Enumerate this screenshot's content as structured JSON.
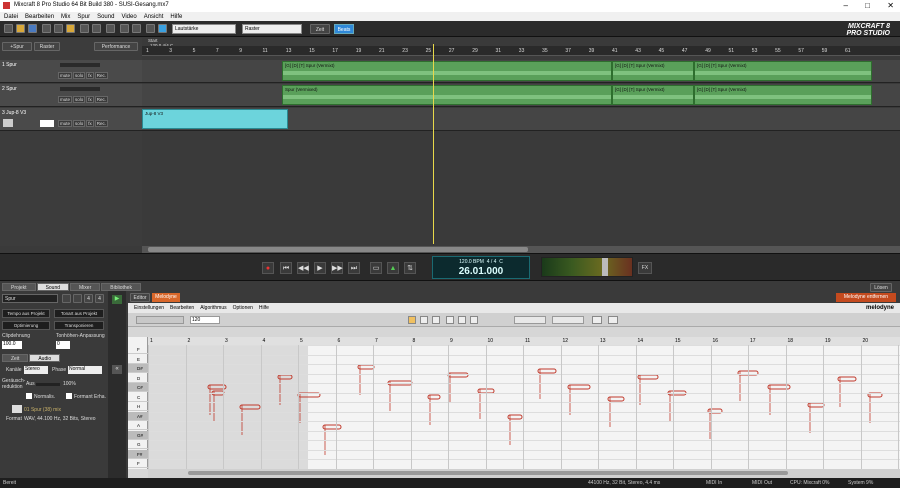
{
  "window": {
    "title": "Mixcraft 8 Pro Studio 64 Bit Build 380 - SUSI-Gesang.mx7"
  },
  "menu": [
    "Datei",
    "Bearbeiten",
    "Mix",
    "Spur",
    "Sound",
    "Video",
    "Ansicht",
    "Hilfe"
  ],
  "toolbar": {
    "volume_combo": "Lautstärke",
    "snap_combo": "Raster",
    "zeit": "Zeit",
    "beats": "Beats"
  },
  "logo": {
    "line1": "MIXCRAFT 8",
    "line2": "PRO STUDIO"
  },
  "trackheader": {
    "add": "+Spur",
    "raster": "Raster",
    "performance": "Performance",
    "mute": "mute",
    "solo": "solo",
    "fx": "fx",
    "rec": "Rec."
  },
  "tracks": [
    {
      "name": "1 Spur"
    },
    {
      "name": "2 Spur"
    },
    {
      "name": "3 Jup-8 V3"
    }
  ],
  "ruler": {
    "start": "Start",
    "tempo": "120.0 4/4 C",
    "bars": [
      "1",
      "3",
      "5",
      "7",
      "9",
      "11",
      "13",
      "15",
      "17",
      "19",
      "21",
      "23",
      "25",
      "27",
      "29",
      "31",
      "33",
      "35",
      "37",
      "39",
      "41",
      "43",
      "45",
      "47",
      "49",
      "51",
      "53",
      "55",
      "57",
      "59",
      "61"
    ]
  },
  "clips": {
    "audio": "Spur (Vermixed)",
    "audio_alt": "[G] [D] [T] Spur (Vermixt)",
    "midi": "Jup-8 V3"
  },
  "transport": {
    "bpm": "120.0 BPM",
    "sig": "4 / 4",
    "key": "C",
    "time": "26.01.000",
    "fx": "FX"
  },
  "lower_tabs": [
    "Projekt",
    "Sound",
    "Mixer",
    "Bibliothek"
  ],
  "lower_active": "Sound",
  "unlock": "Lösen",
  "left": {
    "track_name": "Spur",
    "num1": "4",
    "num2": "4",
    "tempo_proj": "Tempo aus Projekt",
    "tonart_proj": "Tonart aus Projekt",
    "opt": "Optimierung",
    "transp": "Transponieren",
    "clipdehnung": "Clipdehnung",
    "tonhoehe": "Tonhöhen-Anpassung",
    "val1": "100.0",
    "val2": "0",
    "tab_zeit": "Zeit",
    "tab_audio": "Audio",
    "kanale": "Kanäle",
    "kanale_val": "Stereo",
    "phase": "Phase",
    "phase_val": "Normal",
    "gerausch": "Geräusch-reduktion",
    "aus": "Aus",
    "pct": "100%",
    "normal": "Normalis.",
    "formant": "Formant Erha.",
    "file": "01 Spur (38) mix",
    "format_lbl": "Format",
    "format": "WAV, 44.100 Hz, 32 Bits, Stereo"
  },
  "melodyne": {
    "edit": "Editor",
    "plugin": "Melodyne",
    "remove": "Melodyne entfernen",
    "menu": [
      "Einstellungen",
      "Bearbeiten",
      "Algorithmus",
      "Optionen",
      "Hilfe"
    ],
    "brand": "melodyne",
    "zoom": "120",
    "keys": [
      "F",
      "E",
      "D#",
      "D",
      "C#",
      "C",
      "H",
      "A#",
      "A",
      "G#",
      "G",
      "F#",
      "F"
    ],
    "bars": [
      "1",
      "2",
      "3",
      "4",
      "5",
      "6",
      "7",
      "8",
      "9",
      "10",
      "11",
      "12",
      "13",
      "14",
      "15",
      "16",
      "17",
      "18",
      "19",
      "20",
      "21"
    ]
  },
  "status": {
    "ready": "Bereit",
    "audio": "44100 Hz, 32 Bit, Stereo, 4.4 ms",
    "midi_in": "MIDI In",
    "midi_out": "MIDI Out",
    "cpu": "CPU: Mixcraft 0%",
    "system": "System 9%"
  },
  "colors": {
    "clip_green": "#5aa05a",
    "clip_cyan": "#6cd4dc",
    "blob": "#c0392b",
    "accent_blue": "#2f88d8"
  }
}
